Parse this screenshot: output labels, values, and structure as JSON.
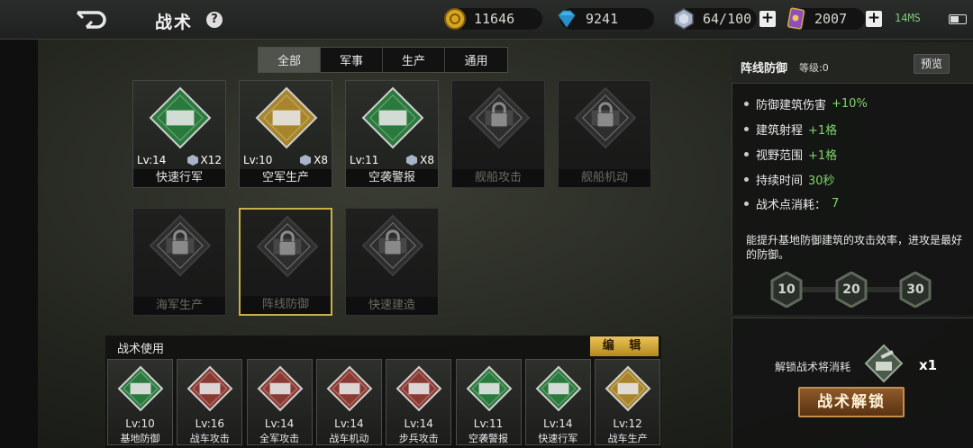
{
  "header": {
    "title": "战术",
    "help": "?",
    "gold": "11646",
    "gems": "9241",
    "crystal": "64/100",
    "cards": "2007",
    "ping": "14MS",
    "colors": {
      "gold": "#d9a521",
      "gem": "#3fb1e8",
      "crystal": "#a8b3c8",
      "card": "#8e4fb8"
    }
  },
  "tabs": [
    {
      "label": "全部",
      "active": true
    },
    {
      "label": "军事",
      "active": false
    },
    {
      "label": "生产",
      "active": false
    },
    {
      "label": "通用",
      "active": false
    }
  ],
  "tactics": [
    {
      "name": "快速行军",
      "level": "Lv:14",
      "count": "X12",
      "locked": false,
      "icon": "lightning-icon",
      "color": "#2b7a3d"
    },
    {
      "name": "空军生产",
      "level": "Lv:10",
      "count": "X8",
      "locked": false,
      "icon": "jet-gear-icon",
      "color": "#a8852a"
    },
    {
      "name": "空袭警报",
      "level": "Lv:11",
      "count": "X8",
      "locked": false,
      "icon": "radar-tower-icon",
      "color": "#2b7a3d"
    },
    {
      "name": "舰船攻击",
      "level": "",
      "count": "",
      "locked": true,
      "icon": "warship-lock-icon",
      "color": "#3a3a3a"
    },
    {
      "name": "舰船机动",
      "level": "",
      "count": "",
      "locked": true,
      "icon": "warship-lock-icon",
      "color": "#3a3a3a"
    },
    {
      "name": "海军生产",
      "level": "",
      "count": "",
      "locked": true,
      "icon": "navy-gear-lock-icon",
      "color": "#3a3a3a"
    },
    {
      "name": "阵线防御",
      "level": "",
      "count": "",
      "locked": true,
      "icon": "turret-lock-icon",
      "color": "#3a3a3a"
    },
    {
      "name": "快速建造",
      "level": "",
      "count": "",
      "locked": true,
      "icon": "build-lock-icon",
      "color": "#3a3a3a"
    }
  ],
  "usage": {
    "title": "战术使用",
    "edit": "编 辑",
    "items": [
      {
        "name": "基地防御",
        "level": "Lv:10",
        "icon": "shield-helmet-icon"
      },
      {
        "name": "战车攻击",
        "level": "Lv:16",
        "icon": "tank-attack-icon"
      },
      {
        "name": "全军攻击",
        "level": "Lv:14",
        "icon": "soldier-icon"
      },
      {
        "name": "战车机动",
        "level": "Lv:14",
        "icon": "tank-move-icon"
      },
      {
        "name": "步兵攻击",
        "level": "Lv:14",
        "icon": "infantry-icon"
      },
      {
        "name": "空袭警报",
        "level": "Lv:11",
        "icon": "radar-tower-icon"
      },
      {
        "name": "快速行军",
        "level": "Lv:14",
        "icon": "lightning-icon"
      },
      {
        "name": "战车生产",
        "level": "Lv:12",
        "icon": "tank-gear-icon"
      }
    ]
  },
  "detail": {
    "title": "阵线防御",
    "level": "等级:0",
    "preview": "预览",
    "effects": [
      {
        "label": "防御建筑伤害",
        "value": "+10%"
      },
      {
        "label": "建筑射程",
        "value": "+1格"
      },
      {
        "label": "视野范围",
        "value": "+1格"
      },
      {
        "label": "持续时间",
        "value": "30秒"
      },
      {
        "label": "战术点消耗：",
        "value": "7"
      }
    ],
    "description": "能提升基地防御建筑的攻击效率，进攻是最好的防御。",
    "milestones": [
      "10",
      "20",
      "30"
    ],
    "unlock_label": "解锁战术将消耗",
    "unlock_qty": "x1",
    "unlock_button": "战术解锁"
  }
}
